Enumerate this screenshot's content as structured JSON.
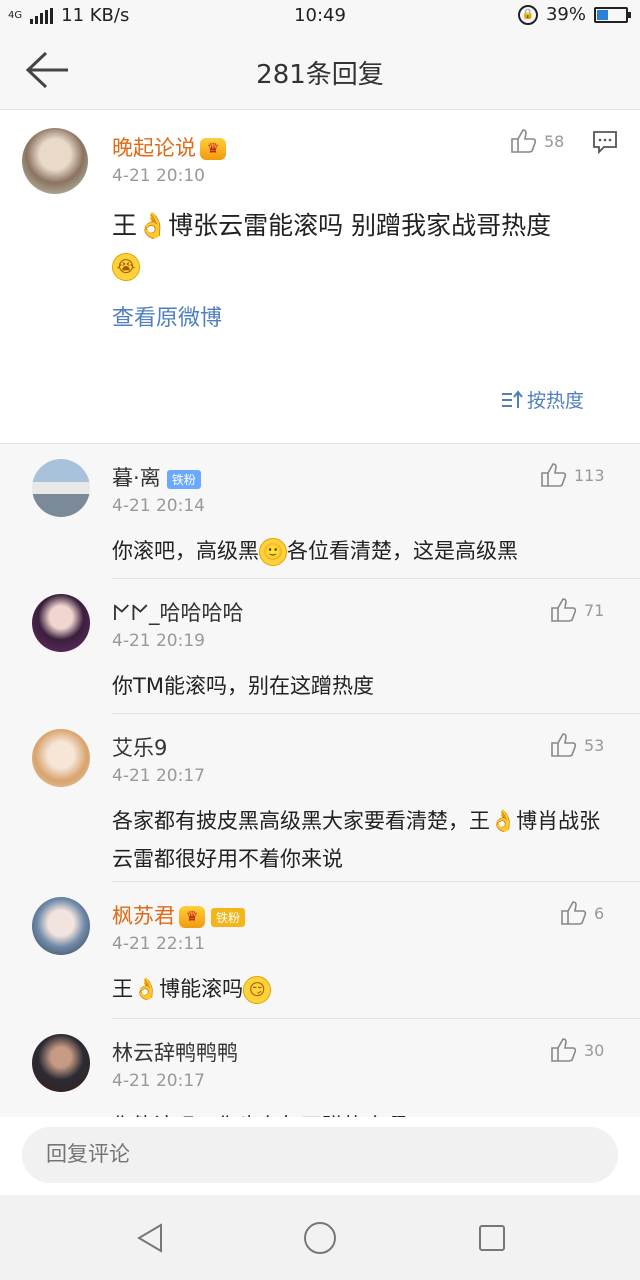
{
  "status": {
    "network": "4G",
    "speed": "11 KB/s",
    "time": "10:49",
    "battery_text": "39%",
    "battery_level": 39
  },
  "header": {
    "title": "281条回复"
  },
  "main_comment": {
    "username": "晚起论说",
    "time": "4-21 20:10",
    "likes": "58",
    "text": "王👌博张云雷能滚吗 别蹭我家战哥热度",
    "view_original": "查看原微博",
    "sort_label": "按热度"
  },
  "replies": [
    {
      "username": "暮·离",
      "badge": "铁粉",
      "time": "4-21 20:14",
      "likes": "113",
      "text_before": "你滚吧，高级黑",
      "text_after": "各位看清楚，这是高级黑"
    },
    {
      "username": "𐌍𐌍_哈哈哈哈",
      "badge": "",
      "time": "4-21 20:19",
      "likes": "71",
      "text": "你TM能滚吗，别在这蹭热度"
    },
    {
      "username": "艾乐9",
      "badge": "",
      "time": "4-21 20:17",
      "likes": "53",
      "text": "各家都有披皮黑高级黑大家要看清楚，王👌博肖战张云雷都很好用不着你来说"
    },
    {
      "username": "枫苏君",
      "badge": "铁粉",
      "time": "4-21 22:11",
      "likes": "6",
      "text": "王👌博能滚吗"
    },
    {
      "username": "林云辞鸭鸭鸭",
      "badge": "",
      "time": "4-21 20:17",
      "likes": "30",
      "text": "你能滚吗！你也有每天蹭热度啊"
    }
  ],
  "reply_input": {
    "placeholder": "回复评论"
  },
  "icons": {
    "back": "back-arrow-icon",
    "like": "thumbs-up-icon",
    "message": "comment-bubble-icon",
    "sort": "sort-icon",
    "nav_back": "triangle-back-icon",
    "nav_home": "circle-home-icon",
    "nav_recent": "square-recent-icon"
  },
  "colors": {
    "vip_name": "#e06a16",
    "link": "#4f7fbf",
    "badge_blue": "#6aa9ff",
    "badge_gold": "#f2b51a"
  }
}
